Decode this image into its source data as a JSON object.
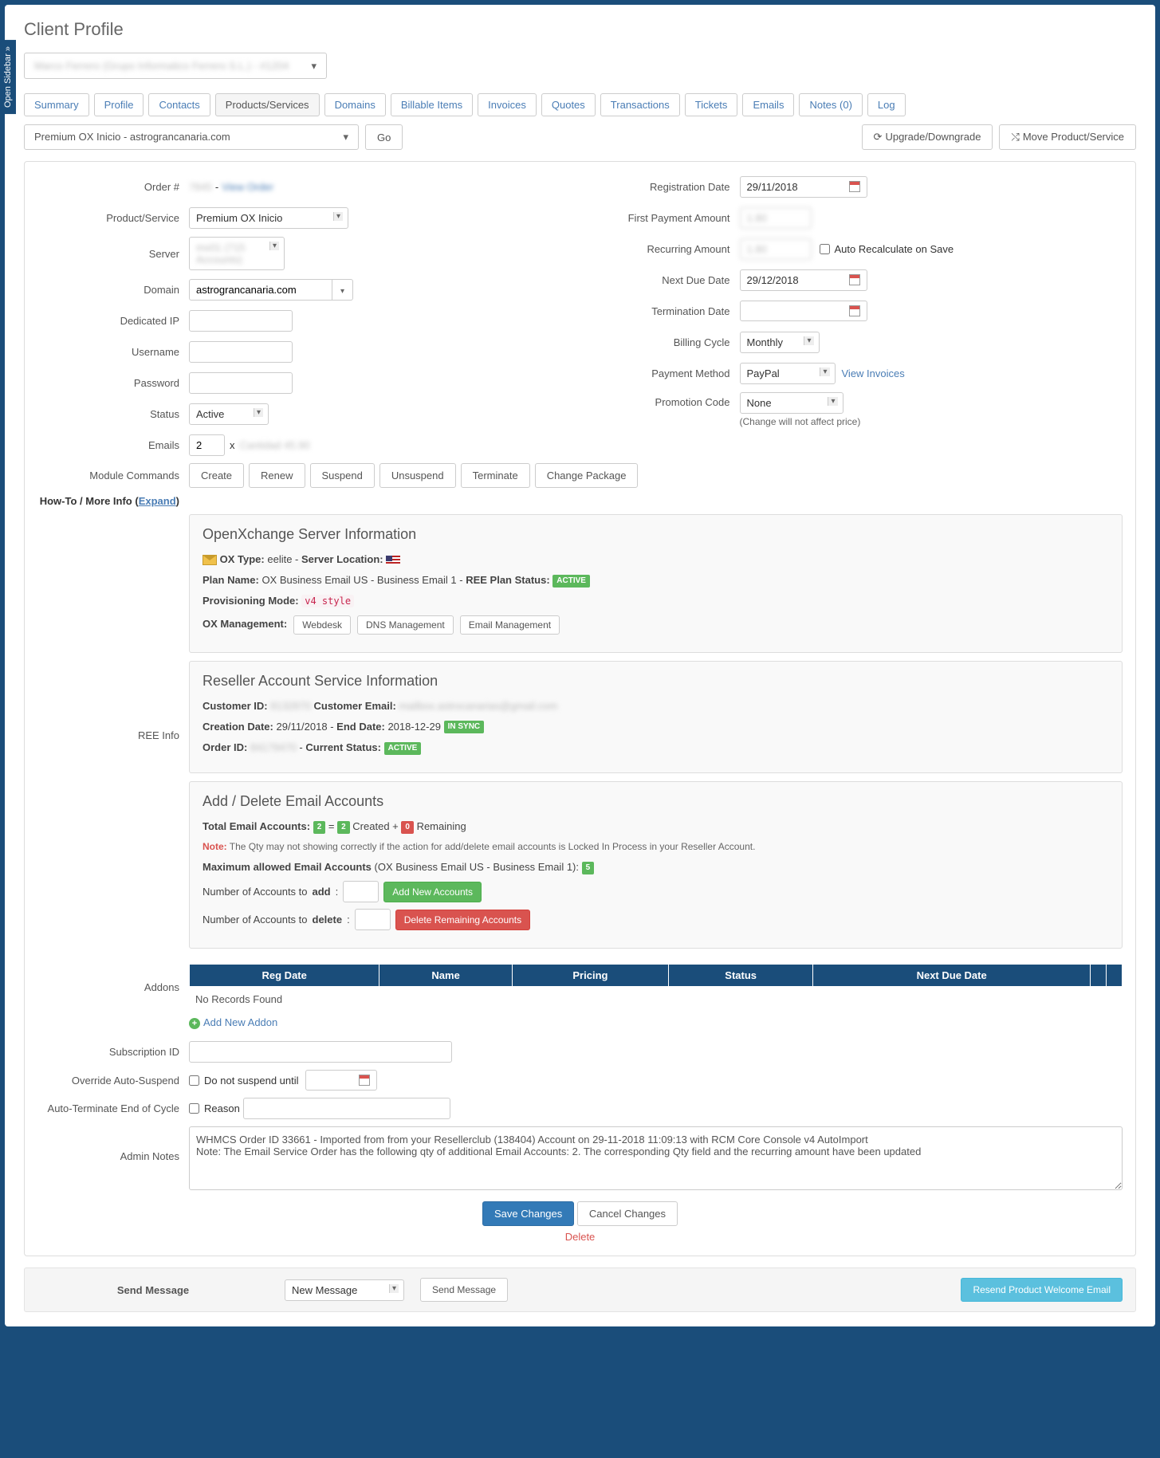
{
  "sidebarTab": "Open Sidebar »",
  "pageTitle": "Client Profile",
  "clientSelectValue": "Marco Ferrero (Grupo Informatico Ferrero S.L.) - #1204",
  "tabs": [
    "Summary",
    "Profile",
    "Contacts",
    "Products/Services",
    "Domains",
    "Billable Items",
    "Invoices",
    "Quotes",
    "Transactions",
    "Tickets",
    "Emails",
    "Notes (0)",
    "Log"
  ],
  "activeTab": "Products/Services",
  "serviceSelect": "Premium OX Inicio - astrograncanaria.com",
  "goBtn": "Go",
  "upgradeBtn": "Upgrade/Downgrade",
  "moveBtn": "Move Product/Service",
  "leftFields": {
    "orderLabel": "Order #",
    "orderValue": "7845",
    "viewOrder": "View Order",
    "productLabel": "Product/Service",
    "productValue": "Premium OX Inicio",
    "serverLabel": "Server",
    "serverValue": "mx01 (715 Accounts)",
    "domainLabel": "Domain",
    "domainValue": "astrograncanaria.com",
    "dedicatedIpLabel": "Dedicated IP",
    "dedicatedIpValue": "",
    "usernameLabel": "Username",
    "usernameValue": "",
    "passwordLabel": "Password",
    "passwordValue": "",
    "statusLabel": "Status",
    "statusValue": "Active"
  },
  "rightFields": {
    "regDateLabel": "Registration Date",
    "regDateValue": "29/11/2018",
    "firstPayLabel": "First Payment Amount",
    "firstPayValue": "1.80",
    "recurLabel": "Recurring Amount",
    "recurValue": "1.80",
    "autoRecalc": "Auto Recalculate on Save",
    "nextDueLabel": "Next Due Date",
    "nextDueValue": "29/12/2018",
    "termLabel": "Termination Date",
    "termValue": "",
    "billingLabel": "Billing Cycle",
    "billingValue": "Monthly",
    "payMethodLabel": "Payment Method",
    "payMethodValue": "PayPal",
    "viewInvoices": "View Invoices",
    "promoLabel": "Promotion Code",
    "promoValue": "None",
    "promoHelp": "(Change will not affect price)"
  },
  "emailsLabel": "Emails",
  "emailsValue": "2",
  "emailsX": "x",
  "emailsUnit": "Cantidad 45.90",
  "moduleCmdsLabel": "Module Commands",
  "moduleCmds": [
    "Create",
    "Renew",
    "Suspend",
    "Unsuspend",
    "Terminate",
    "Change Package"
  ],
  "howToLabel": "How-To / More Info (",
  "howToExpand": "Expand",
  "howToClose": ")",
  "reeInfoLabel": "REE Info",
  "oxPanel": {
    "title": "OpenXchange Server Information",
    "oxTypeLabel": "OX Type:",
    "oxType": "eelite",
    "serverLocLabel": "Server Location:",
    "planNameLabel": "Plan Name:",
    "planName": "OX Business Email US - Business Email 1",
    "reePlanStatusLabel": "REE Plan Status:",
    "reePlanStatus": "ACTIVE",
    "provModeLabel": "Provisioning Mode:",
    "provMode": "v4 style",
    "oxMgmtLabel": "OX Management:",
    "oxMgmtBtns": [
      "Webdesk",
      "DNS Management",
      "Email Management"
    ]
  },
  "resellerPanel": {
    "title": "Reseller Account Service Information",
    "custIdLabel": "Customer ID:",
    "custId": "8132870",
    "custEmailLabel": "Customer Email:",
    "custEmail": "mailbox.astrocanarias@gmail.com",
    "createDateLabel": "Creation Date:",
    "createDate": "29/11/2018",
    "endDateLabel": "End Date:",
    "endDate": "2018-12-29",
    "syncBadge": "IN SYNC",
    "orderIdLabel": "Order ID:",
    "orderId": "84179470",
    "currentStatusLabel": "Current Status:",
    "currentStatus": "ACTIVE"
  },
  "emailPanel": {
    "title": "Add / Delete Email Accounts",
    "totalLabel": "Total Email Accounts:",
    "totalVal": "2",
    "eq": "=",
    "createdVal": "2",
    "createdTxt": "Created +",
    "remainVal": "0",
    "remainTxt": "Remaining",
    "noteLabel": "Note:",
    "noteText": "The Qty may not showing correctly if the action for add/delete email accounts is Locked In Process in your Reseller Account.",
    "maxLabel": "Maximum allowed Email Accounts",
    "maxPlan": "(OX Business Email US - Business Email 1):",
    "maxVal": "5",
    "addLabel": "Number of Accounts to",
    "addBold": "add",
    "addBtn": "Add New Accounts",
    "delLabel": "Number of Accounts to",
    "delBold": "delete",
    "delBtn": "Delete Remaining Accounts"
  },
  "addonsLabel": "Addons",
  "addonsHeaders": [
    "Reg Date",
    "Name",
    "Pricing",
    "Status",
    "Next Due Date"
  ],
  "noRecords": "No Records Found",
  "addNewAddon": "Add New Addon",
  "subIdLabel": "Subscription ID",
  "overrideLabel": "Override Auto-Suspend",
  "overrideCheck": "Do not suspend until",
  "autoTermLabel": "Auto-Terminate End of Cycle",
  "autoTermCheck": "Reason",
  "adminNotesLabel": "Admin Notes",
  "adminNotesValue": "WHMCS Order ID 33661 - Imported from from your Resellerclub (138404) Account on 29-11-2018 11:09:13 with RCM Core Console v4 AutoImport\nNote: The Email Service Order has the following qty of additional Email Accounts: 2. The corresponding Qty field and the recurring amount have been updated",
  "saveBtn": "Save Changes",
  "cancelBtn": "Cancel Changes",
  "deleteLink": "Delete",
  "sendMsgLabel": "Send Message",
  "sendMsgSelect": "New Message",
  "sendMsgBtn": "Send Message",
  "resendBtn": "Resend Product Welcome Email"
}
